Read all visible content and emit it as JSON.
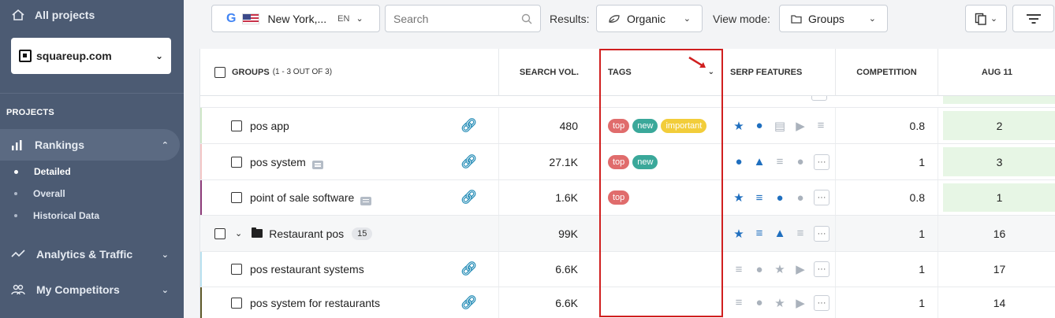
{
  "sidebar": {
    "all_projects": "All projects",
    "project": "squareup.com",
    "section": "PROJECTS",
    "items": [
      {
        "label": "Rankings",
        "icon": "bar-chart-icon"
      },
      {
        "label": "Analytics & Traffic",
        "icon": "trend-line-icon"
      },
      {
        "label": "My Competitors",
        "icon": "users-icon"
      }
    ],
    "subitems": [
      "Detailed",
      "Overall",
      "Historical Data"
    ]
  },
  "toolbar": {
    "location": "New York,...",
    "lang": "EN",
    "search_placeholder": "Search",
    "results_label": "Results:",
    "results_value": "Organic",
    "view_label": "View mode:",
    "view_value": "Groups"
  },
  "table": {
    "headers": {
      "groups": "GROUPS",
      "groups_count": "(1 - 3 OUT OF 3)",
      "search_vol": "SEARCH VOL.",
      "tags": "TAGS",
      "serp": "SERP FEATURES",
      "competition": "COMPETITION",
      "date": "AUG 11"
    },
    "rows": [
      {
        "keyword": "pos app",
        "vol": "480",
        "tags": [
          "top",
          "new",
          "important"
        ],
        "comp": "0.8",
        "rank": "2"
      },
      {
        "keyword": "pos system",
        "vol": "27.1K",
        "tags": [
          "top",
          "new"
        ],
        "comp": "1",
        "rank": "3"
      },
      {
        "keyword": "point of sale software",
        "vol": "1.6K",
        "tags": [
          "top"
        ],
        "comp": "0.8",
        "rank": "1"
      },
      {
        "keyword": "Restaurant pos",
        "count": "15",
        "vol": "99K",
        "comp": "1",
        "rank": "16"
      },
      {
        "keyword": "pos restaurant systems",
        "vol": "6.6K",
        "comp": "1",
        "rank": "17"
      },
      {
        "keyword": "pos system for restaurants",
        "vol": "6.6K",
        "comp": "1",
        "rank": "14"
      }
    ]
  },
  "colors": {
    "sidebar_bg": "#4c5b73",
    "tag_top": "#e06c6c",
    "tag_new": "#3aa89a",
    "tag_important": "#f2cd3a",
    "rank_bg": "#e7f6e5",
    "highlight": "#d01f1f"
  }
}
